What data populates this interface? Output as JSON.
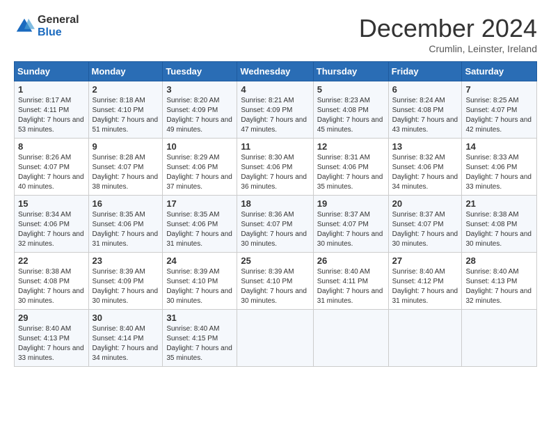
{
  "logo": {
    "general": "General",
    "blue": "Blue"
  },
  "title": "December 2024",
  "subtitle": "Crumlin, Leinster, Ireland",
  "days_of_week": [
    "Sunday",
    "Monday",
    "Tuesday",
    "Wednesday",
    "Thursday",
    "Friday",
    "Saturday"
  ],
  "weeks": [
    [
      {
        "day": "1",
        "sunrise": "8:17 AM",
        "sunset": "4:11 PM",
        "daylight": "7 hours and 53 minutes."
      },
      {
        "day": "2",
        "sunrise": "8:18 AM",
        "sunset": "4:10 PM",
        "daylight": "7 hours and 51 minutes."
      },
      {
        "day": "3",
        "sunrise": "8:20 AM",
        "sunset": "4:09 PM",
        "daylight": "7 hours and 49 minutes."
      },
      {
        "day": "4",
        "sunrise": "8:21 AM",
        "sunset": "4:09 PM",
        "daylight": "7 hours and 47 minutes."
      },
      {
        "day": "5",
        "sunrise": "8:23 AM",
        "sunset": "4:08 PM",
        "daylight": "7 hours and 45 minutes."
      },
      {
        "day": "6",
        "sunrise": "8:24 AM",
        "sunset": "4:08 PM",
        "daylight": "7 hours and 43 minutes."
      },
      {
        "day": "7",
        "sunrise": "8:25 AM",
        "sunset": "4:07 PM",
        "daylight": "7 hours and 42 minutes."
      }
    ],
    [
      {
        "day": "8",
        "sunrise": "8:26 AM",
        "sunset": "4:07 PM",
        "daylight": "7 hours and 40 minutes."
      },
      {
        "day": "9",
        "sunrise": "8:28 AM",
        "sunset": "4:07 PM",
        "daylight": "7 hours and 38 minutes."
      },
      {
        "day": "10",
        "sunrise": "8:29 AM",
        "sunset": "4:06 PM",
        "daylight": "7 hours and 37 minutes."
      },
      {
        "day": "11",
        "sunrise": "8:30 AM",
        "sunset": "4:06 PM",
        "daylight": "7 hours and 36 minutes."
      },
      {
        "day": "12",
        "sunrise": "8:31 AM",
        "sunset": "4:06 PM",
        "daylight": "7 hours and 35 minutes."
      },
      {
        "day": "13",
        "sunrise": "8:32 AM",
        "sunset": "4:06 PM",
        "daylight": "7 hours and 34 minutes."
      },
      {
        "day": "14",
        "sunrise": "8:33 AM",
        "sunset": "4:06 PM",
        "daylight": "7 hours and 33 minutes."
      }
    ],
    [
      {
        "day": "15",
        "sunrise": "8:34 AM",
        "sunset": "4:06 PM",
        "daylight": "7 hours and 32 minutes."
      },
      {
        "day": "16",
        "sunrise": "8:35 AM",
        "sunset": "4:06 PM",
        "daylight": "7 hours and 31 minutes."
      },
      {
        "day": "17",
        "sunrise": "8:35 AM",
        "sunset": "4:06 PM",
        "daylight": "7 hours and 31 minutes."
      },
      {
        "day": "18",
        "sunrise": "8:36 AM",
        "sunset": "4:07 PM",
        "daylight": "7 hours and 30 minutes."
      },
      {
        "day": "19",
        "sunrise": "8:37 AM",
        "sunset": "4:07 PM",
        "daylight": "7 hours and 30 minutes."
      },
      {
        "day": "20",
        "sunrise": "8:37 AM",
        "sunset": "4:07 PM",
        "daylight": "7 hours and 30 minutes."
      },
      {
        "day": "21",
        "sunrise": "8:38 AM",
        "sunset": "4:08 PM",
        "daylight": "7 hours and 30 minutes."
      }
    ],
    [
      {
        "day": "22",
        "sunrise": "8:38 AM",
        "sunset": "4:08 PM",
        "daylight": "7 hours and 30 minutes."
      },
      {
        "day": "23",
        "sunrise": "8:39 AM",
        "sunset": "4:09 PM",
        "daylight": "7 hours and 30 minutes."
      },
      {
        "day": "24",
        "sunrise": "8:39 AM",
        "sunset": "4:10 PM",
        "daylight": "7 hours and 30 minutes."
      },
      {
        "day": "25",
        "sunrise": "8:39 AM",
        "sunset": "4:10 PM",
        "daylight": "7 hours and 30 minutes."
      },
      {
        "day": "26",
        "sunrise": "8:40 AM",
        "sunset": "4:11 PM",
        "daylight": "7 hours and 31 minutes."
      },
      {
        "day": "27",
        "sunrise": "8:40 AM",
        "sunset": "4:12 PM",
        "daylight": "7 hours and 31 minutes."
      },
      {
        "day": "28",
        "sunrise": "8:40 AM",
        "sunset": "4:13 PM",
        "daylight": "7 hours and 32 minutes."
      }
    ],
    [
      {
        "day": "29",
        "sunrise": "8:40 AM",
        "sunset": "4:13 PM",
        "daylight": "7 hours and 33 minutes."
      },
      {
        "day": "30",
        "sunrise": "8:40 AM",
        "sunset": "4:14 PM",
        "daylight": "7 hours and 34 minutes."
      },
      {
        "day": "31",
        "sunrise": "8:40 AM",
        "sunset": "4:15 PM",
        "daylight": "7 hours and 35 minutes."
      },
      null,
      null,
      null,
      null
    ]
  ],
  "labels": {
    "sunrise": "Sunrise:",
    "sunset": "Sunset:",
    "daylight": "Daylight:"
  }
}
